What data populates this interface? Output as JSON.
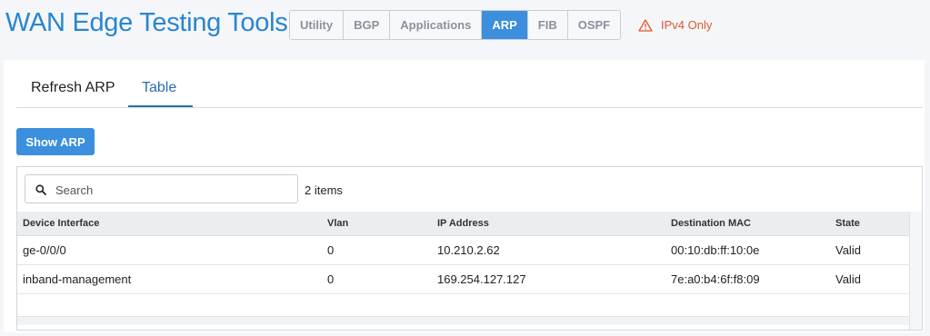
{
  "header": {
    "title": "WAN Edge Testing Tools",
    "tabs": [
      {
        "label": "Utility",
        "active": false
      },
      {
        "label": "BGP",
        "active": false
      },
      {
        "label": "Applications",
        "active": false
      },
      {
        "label": "ARP",
        "active": true
      },
      {
        "label": "FIB",
        "active": false
      },
      {
        "label": "OSPF",
        "active": false
      }
    ],
    "warning": {
      "icon": "warning-triangle-icon",
      "label": "IPv4 Only",
      "color": "#e0582f"
    }
  },
  "subtabs": [
    {
      "label": "Refresh ARP",
      "active": false
    },
    {
      "label": "Table",
      "active": true
    }
  ],
  "show_button": {
    "label": "Show ARP"
  },
  "search": {
    "placeholder": "Search",
    "value": "",
    "icon": "search-icon"
  },
  "item_count": "2 items",
  "table": {
    "columns": [
      "Device Interface",
      "Vlan",
      "IP Address",
      "Destination MAC",
      "State"
    ],
    "rows": [
      [
        "ge-0/0/0",
        "0",
        "10.210.2.62",
        "00:10:db:ff:10:0e",
        "Valid"
      ],
      [
        "inband-management",
        "0",
        "169.254.127.127",
        "7e:a0:b4:6f:f8:09",
        "Valid"
      ]
    ]
  },
  "colors": {
    "accent": "#3b8fdc",
    "title": "#2a85d0",
    "warning": "#e0582f"
  }
}
